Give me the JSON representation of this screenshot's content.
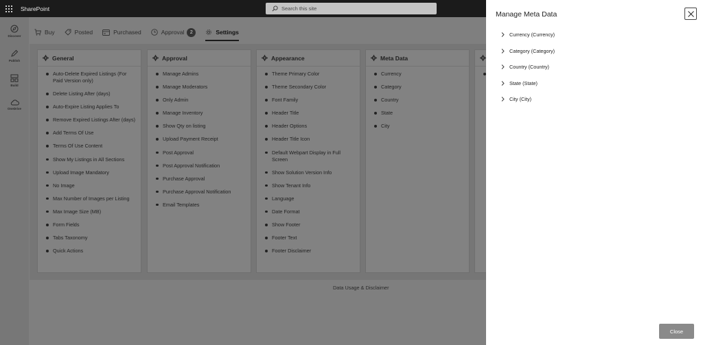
{
  "suitebar": {
    "app_name": "SharePoint",
    "search_placeholder": "Search this site"
  },
  "rail": {
    "items": [
      {
        "label": "Discover",
        "icon": "compass-icon"
      },
      {
        "label": "Publish",
        "icon": "pen-icon"
      },
      {
        "label": "Build",
        "icon": "grid-icon"
      },
      {
        "label": "OneDrive",
        "icon": "cloud-icon"
      }
    ]
  },
  "tabs": [
    {
      "label": "Buy",
      "icon": "cart-icon"
    },
    {
      "label": "Posted",
      "icon": "tag-icon"
    },
    {
      "label": "Purchased",
      "icon": "card-icon"
    },
    {
      "label": "Approval",
      "icon": "clock-icon",
      "badge": "2"
    },
    {
      "label": "Settings",
      "icon": "gear-icon",
      "active": true
    }
  ],
  "cards": [
    {
      "title": "General",
      "items": [
        "Auto-Delete Expired Listings (For Paid Version only)",
        "Delete Listing After (days)",
        "Auto-Expire Listing Applies To",
        "Remove Expired Listings After (days)",
        "Add Terms Of Use",
        "Terms Of Use Content",
        "Show My Listings in All Sections",
        "Upload Image Mandatory",
        "No Image",
        "Max Number of Images per Listing",
        "Max Image Size (MB)",
        "Form Fields",
        "Tabs Taxonomy",
        "Quick Actions"
      ]
    },
    {
      "title": "Approval",
      "items": [
        "Manage Admins",
        "Manage Moderators",
        "Only Admin",
        "Manage Inventory",
        "Show Qty on listing",
        "Upload Payment Receipt",
        "Post Approval",
        "Post Approval Notification",
        "Purchase Approval",
        "Purchase Approval Notification",
        "Email Templates"
      ]
    },
    {
      "title": "Appearance",
      "items": [
        "Theme Primary Color",
        "Theme Secondary Color",
        "Font Family",
        "Header Title",
        "Header Options",
        "Header Title Icon",
        "Default Webpart Display in Full Screen",
        "Show Solution Version Info",
        "Show Tenant Info",
        "Language",
        "Date Format",
        "Show Footer",
        "Footer Text",
        "Footer Disclaimer"
      ]
    },
    {
      "title": "Meta Data",
      "items": [
        "Currency",
        "Category",
        "Country",
        "State",
        "City"
      ]
    },
    {
      "title": "",
      "items": [
        ""
      ]
    }
  ],
  "footer": {
    "link": "Data Usage & Disclaimer"
  },
  "flyout": {
    "title": "Manage Meta Data",
    "tree": [
      "Currency (Currency)",
      "Category (Category)",
      "Country (Country)",
      "State (State)",
      "City (City)"
    ],
    "close_label": "Close"
  }
}
